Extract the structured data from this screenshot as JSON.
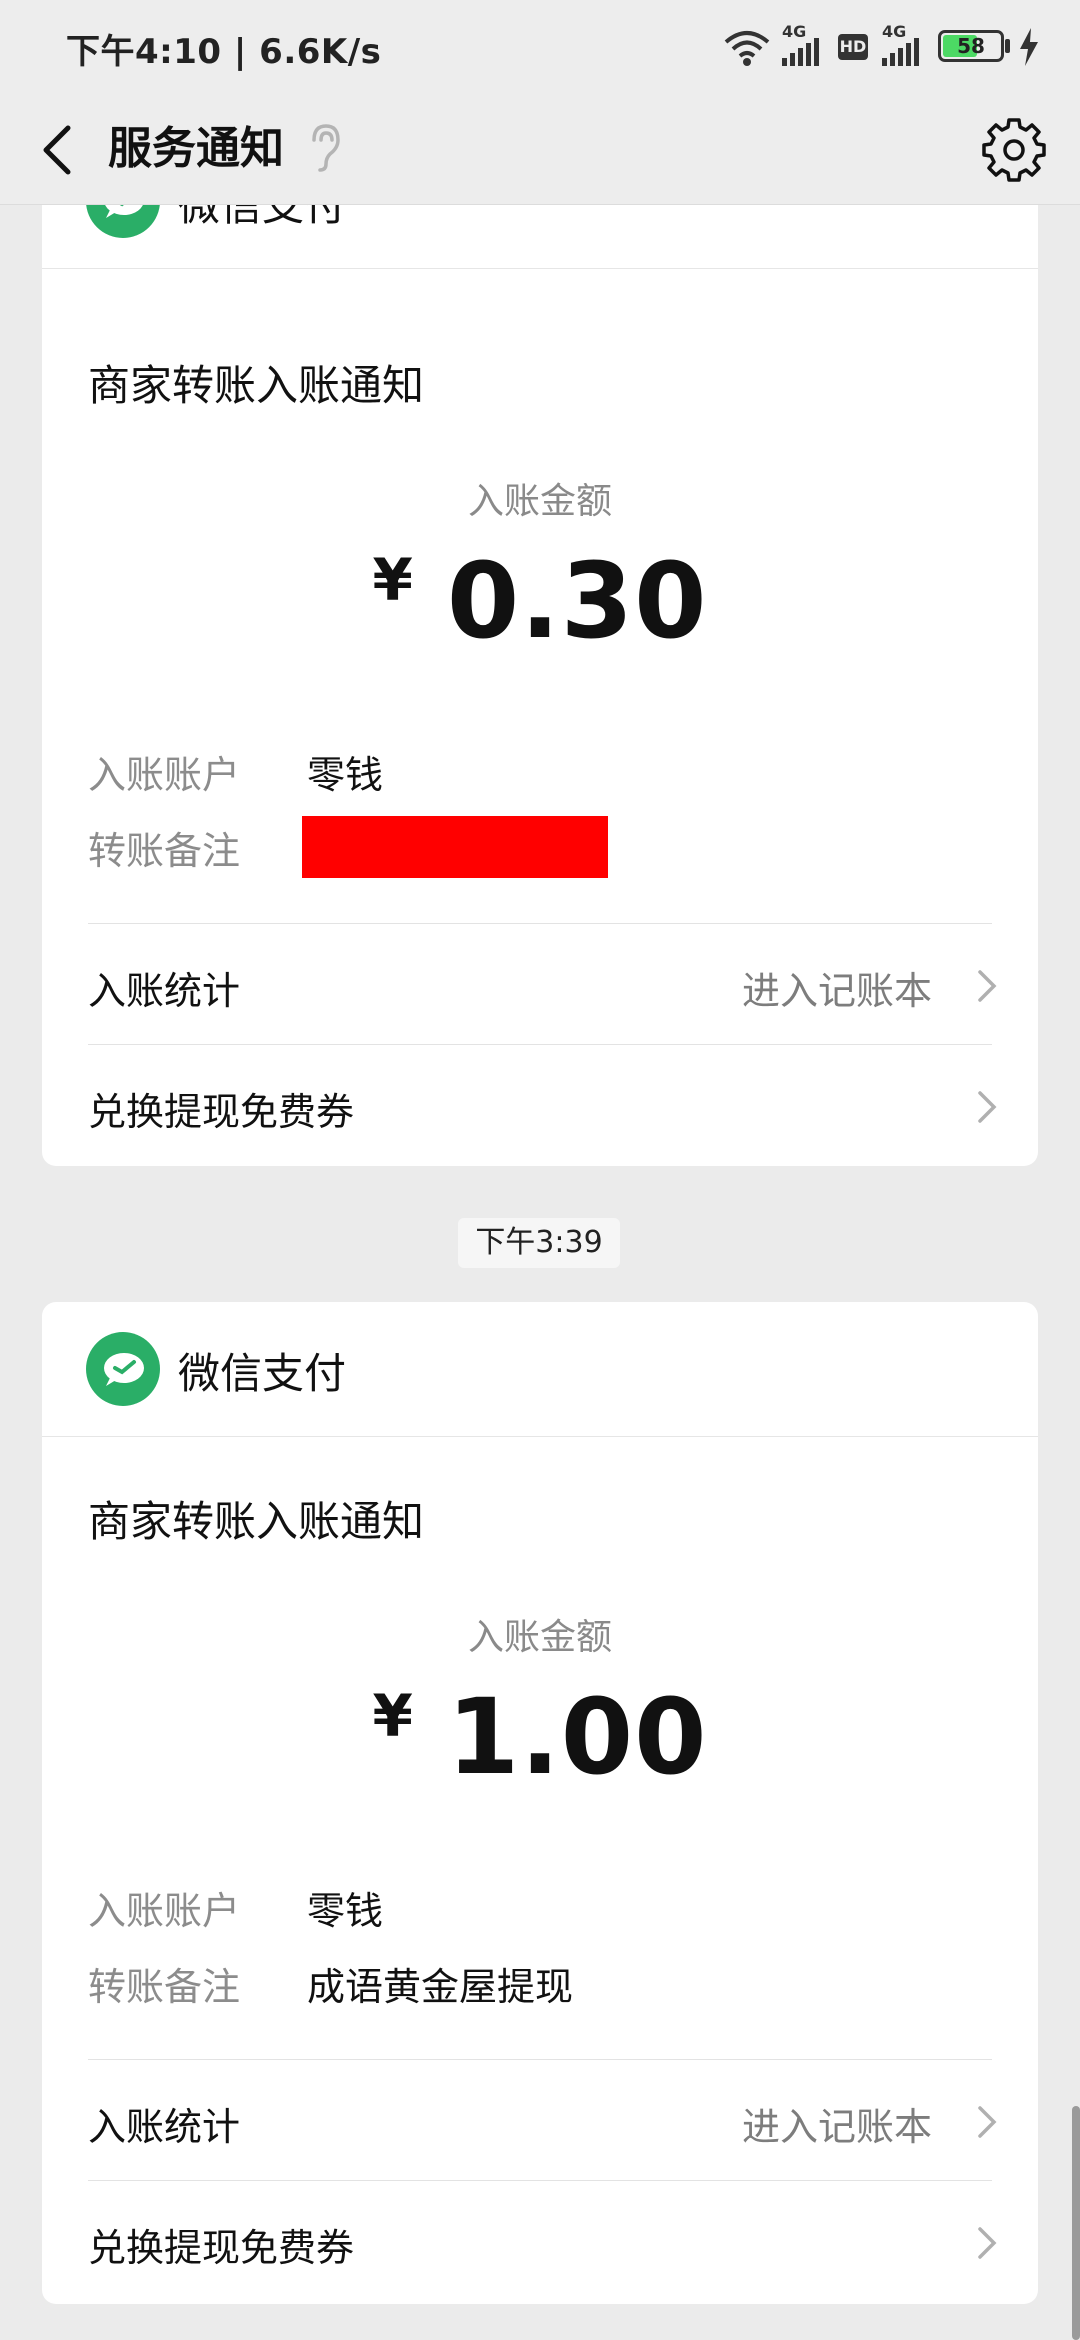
{
  "status_bar": {
    "time_speed": "下午4:10 | 6.6K/s",
    "network1": "4G",
    "hd": "HD",
    "network2": "4G",
    "battery": "58"
  },
  "header": {
    "title": "服务通知"
  },
  "cards": [
    {
      "sender": "微信支付",
      "title": "商家转账入账通知",
      "amount_label": "入账金额",
      "currency": "¥",
      "amount": "0.30",
      "account_label": "入账账户",
      "account_value": "零钱",
      "note_label": "转账备注",
      "note_value": "",
      "stats_label": "入账统计",
      "stats_link": "进入记账本",
      "coupon_label": "兑换提现免费券"
    },
    {
      "sender": "微信支付",
      "title": "商家转账入账通知",
      "amount_label": "入账金额",
      "currency": "¥",
      "amount": "1.00",
      "account_label": "入账账户",
      "account_value": "零钱",
      "note_label": "转账备注",
      "note_value": "成语黄金屋提现",
      "stats_label": "入账统计",
      "stats_link": "进入记账本",
      "coupon_label": "兑换提现免费券"
    }
  ],
  "timestamp": "下午3:39",
  "colors": {
    "wechat_pay_green": "#2aae67",
    "redaction": "#ff0000",
    "battery_fill": "#4cd964"
  }
}
